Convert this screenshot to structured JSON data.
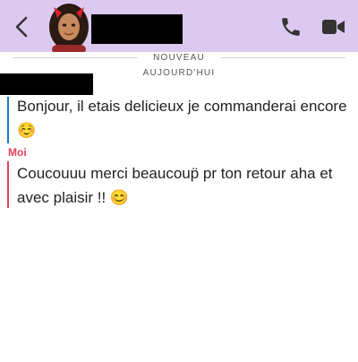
{
  "header": {
    "back_icon": "chevron-left-icon",
    "call_icon": "phone-icon",
    "video_icon": "video-camera-icon"
  },
  "divider": {
    "new_label": "NOUVEAU",
    "date_label": "AUJOURD'HUI"
  },
  "messages": [
    {
      "sender": "",
      "text": "Bonjour, il etais delicieux je commanderai encore ☺️",
      "accent": "#1a7ac9"
    },
    {
      "sender": "Moi",
      "text": "Coucouuu merci beaucoup̈ pr ton retour aha et avec plaisir !! 😊",
      "accent": "#e0425a"
    }
  ],
  "colors": {
    "header_bg": "#dcc9f0",
    "icon": "#333333",
    "incoming_accent": "#1a7ac9",
    "outgoing_accent": "#e0425a"
  }
}
